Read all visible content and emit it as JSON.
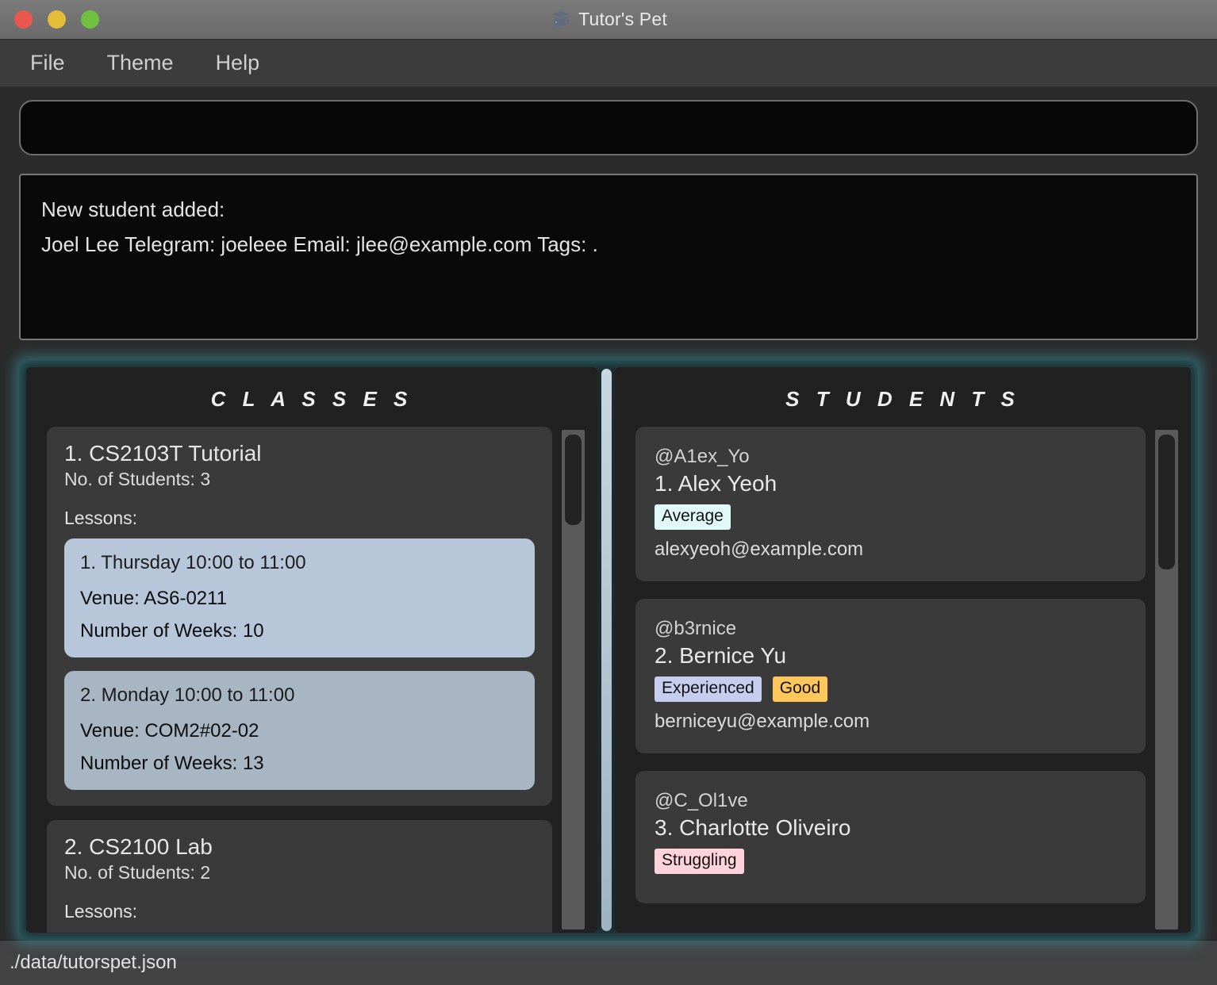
{
  "window": {
    "title": "Tutor's Pet",
    "icon": "graduation-cap-icon",
    "traffic_lights": [
      {
        "name": "close",
        "color": "#e8584f"
      },
      {
        "name": "minimize",
        "color": "#e3bc3a"
      },
      {
        "name": "maximize",
        "color": "#6fc240"
      }
    ]
  },
  "menubar": {
    "items": [
      {
        "label": "File"
      },
      {
        "label": "Theme"
      },
      {
        "label": "Help"
      }
    ]
  },
  "command_box": {
    "value": "",
    "placeholder": ""
  },
  "result_display": {
    "lines": [
      "New student added:",
      "Joel Lee Telegram: joeleee Email: jlee@example.com Tags: ."
    ]
  },
  "classes_panel": {
    "header": "C L A S S E S",
    "scrollbar": {
      "thumb_top_pct": 1,
      "thumb_height_pct": 18
    },
    "items": [
      {
        "index": "1.",
        "name": "CS2103T Tutorial",
        "students_label": "No. of Students:  3",
        "lessons_label": "Lessons:",
        "lessons": [
          {
            "title": "1. Thursday 10:00 to 11:00",
            "venue": "Venue: AS6-0211",
            "weeks": "Number of Weeks: 10"
          },
          {
            "title": "2. Monday 10:00 to 11:00",
            "venue": "Venue: COM2#02-02",
            "weeks": "Number of Weeks: 13"
          }
        ]
      },
      {
        "index": "2.",
        "name": "CS2100 Lab",
        "students_label": "No. of Students:  2",
        "lessons_label": "Lessons:",
        "lessons": []
      }
    ]
  },
  "students_panel": {
    "header": "S T U D E N T S",
    "scrollbar": {
      "thumb_top_pct": 1,
      "thumb_height_pct": 27
    },
    "items": [
      {
        "handle": "@A1ex_Yo",
        "name": "1.  Alex Yeoh",
        "tags": [
          {
            "label": "Average",
            "color": "#e0f8f8"
          }
        ],
        "email": "alexyeoh@example.com"
      },
      {
        "handle": "@b3rnice",
        "name": "2.  Bernice Yu",
        "tags": [
          {
            "label": "Experienced",
            "color": "#c6cdee"
          },
          {
            "label": "Good",
            "color": "#ffc martín"
          }
        ],
        "email": "berniceyu@example.com"
      },
      {
        "handle": "@C_Ol1ve",
        "name": "3.  Charlotte Oliveiro",
        "tags": [
          {
            "label": "Struggling",
            "color": "#ffd2dc"
          }
        ],
        "email": ""
      }
    ]
  },
  "statusbar": {
    "path": "./data/tutorspet.json"
  }
}
